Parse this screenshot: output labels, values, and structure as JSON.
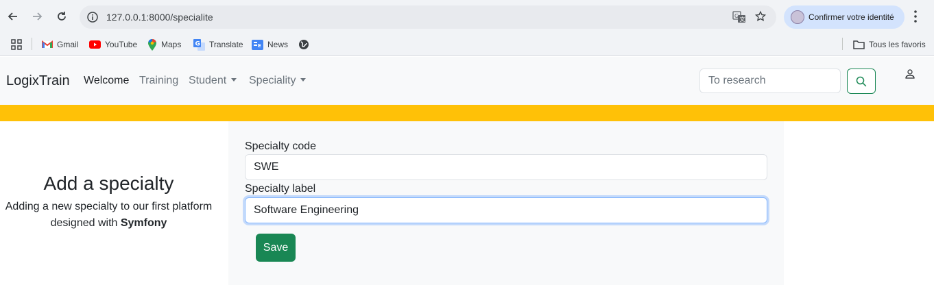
{
  "browser": {
    "url": "127.0.0.1:8000/specialite",
    "profile_label": "Confirmer votre identité",
    "bookmarks": [
      {
        "label": "Gmail",
        "icon": "gmail-icon"
      },
      {
        "label": "YouTube",
        "icon": "youtube-icon"
      },
      {
        "label": "Maps",
        "icon": "maps-icon"
      },
      {
        "label": "Translate",
        "icon": "translate-icon"
      },
      {
        "label": "News",
        "icon": "news-icon"
      }
    ],
    "all_bookmarks_label": "Tous les favoris"
  },
  "navbar": {
    "brand": "LogixTrain",
    "items": [
      {
        "label": "Welcome",
        "active": true
      },
      {
        "label": "Training"
      },
      {
        "label": "Student",
        "dropdown": true
      },
      {
        "label": "Speciality",
        "dropdown": true
      }
    ],
    "search_placeholder": "To research"
  },
  "intro": {
    "heading": "Add a specialty",
    "text_prefix": "Adding a new specialty to our first platform designed with",
    "text_bold": "Symfony"
  },
  "form": {
    "code_label": "Specialty code",
    "code_value": "SWE",
    "label_label": "Specialty label",
    "label_value": "Software Engineering",
    "save_label": "Save"
  },
  "colors": {
    "accent_strip": "#ffc107",
    "primary_button": "#198754",
    "focus_ring": "#86b7fe"
  }
}
